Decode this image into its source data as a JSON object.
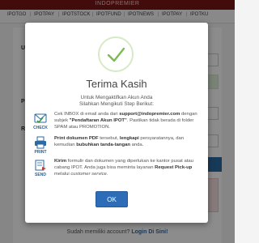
{
  "header": {
    "brand": "INDOPREMIER"
  },
  "nav": {
    "items": [
      "IPOTGO",
      "IPOTPAY",
      "IPOTSTOCK",
      "IPOTFUND",
      "IPOTNEWS",
      "IPOTPAY",
      "IPOTKU"
    ],
    "separator": "|"
  },
  "background_form": {
    "label_1": "Us",
    "label_2": "Pa",
    "label_3": "Re"
  },
  "footer": {
    "prompt": "Sudah memiliki account?",
    "link": "Login Di Sini!"
  },
  "modal": {
    "icon": "check-icon",
    "title": "Terima Kasih",
    "subtitle_line1": "Untuk Mengaktifkan Akun Anda",
    "subtitle_line2": "Silahkan Mengikuti Step Berikut:",
    "steps": [
      {
        "icon": "envelope-check-icon",
        "caption": "CHECK",
        "t1": "Cek INBOX di email anda dari ",
        "b1": "support@indopremier.com",
        "t2": " dengan subjek ",
        "b2": "\"Pendaftaran Akun IPOT\"",
        "t3": ". Pastikan tidak berada di folder SPAM atau PROMOTION."
      },
      {
        "icon": "printer-icon",
        "caption": "PRINT",
        "b1": "Print dokumen PDF",
        "t1": " tersebut, ",
        "b2": "lengkapi",
        "t2": " persyaratannya, dan kemudian ",
        "b3": "bubuhkan tanda-tangan",
        "t3": " anda."
      },
      {
        "icon": "send-icon",
        "caption": "SEND",
        "b1": "Kirim",
        "t1": " formulir dan dokumen yang diperlukan ke kantor pusat atau cabang IPOT. Anda juga bisa meminta layanan ",
        "b2": "Request Pick-up",
        "t2": " melalui ",
        "i1": "customer service",
        "t3": "."
      }
    ],
    "ok_label": "OK"
  },
  "colors": {
    "brand_bar": "#7b1717",
    "accent_blue": "#2d6db8",
    "check_green": "#7dbb4f"
  }
}
